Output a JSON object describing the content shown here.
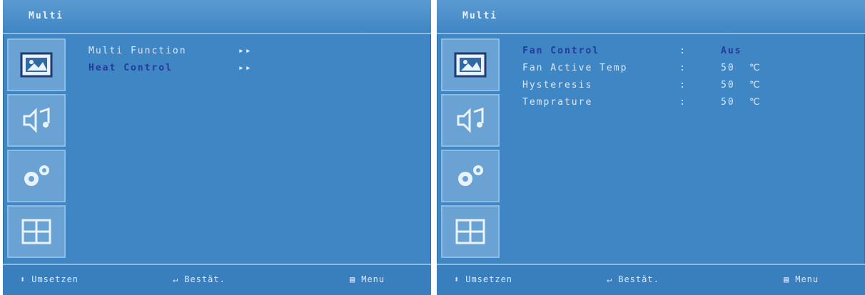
{
  "left_screen": {
    "title": "Multi",
    "sidebar_icons": [
      "picture-icon",
      "sound-icon",
      "settings-gears-icon",
      "multi-window-icon"
    ],
    "menu": [
      {
        "label": "Multi Function",
        "arrow": "▸▸",
        "selected": false
      },
      {
        "label": "Heat Control",
        "arrow": "▸▸",
        "selected": true
      }
    ],
    "footer": {
      "move": "Umsetzen",
      "confirm": "Bestät.",
      "menu": "Menu"
    }
  },
  "right_screen": {
    "title": "Multi",
    "sidebar_icons": [
      "picture-icon",
      "sound-icon",
      "settings-gears-icon",
      "multi-window-icon"
    ],
    "settings": [
      {
        "label": "Fan Control",
        "colon": ":",
        "value": "Aus",
        "unit": "",
        "selected": true
      },
      {
        "label": "Fan Active Temp",
        "colon": ":",
        "value": "50",
        "unit": "℃",
        "selected": false
      },
      {
        "label": "Hysteresis",
        "colon": ":",
        "value": "50",
        "unit": "℃",
        "selected": false
      },
      {
        "label": "Temprature",
        "colon": ":",
        "value": "50",
        "unit": "℃",
        "selected": false
      }
    ],
    "footer": {
      "move": "Umsetzen",
      "confirm": "Bestät.",
      "menu": "Menu"
    }
  },
  "colors": {
    "background": "#3f86c4",
    "selected_text": "#263a9a",
    "text": "#dbe9ff"
  }
}
